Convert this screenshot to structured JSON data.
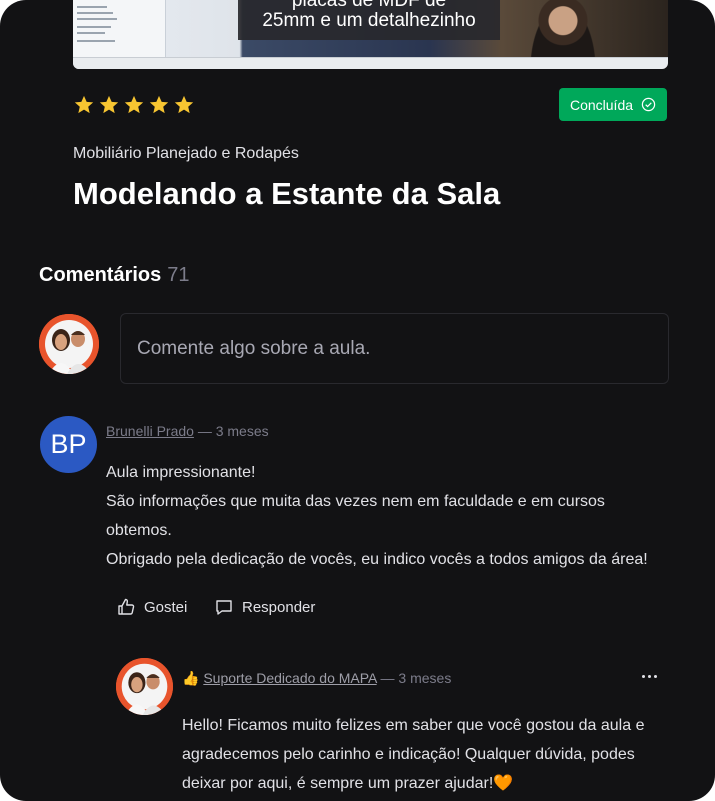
{
  "video": {
    "caption_line1": "placas de MDF de",
    "caption_line2": "25mm e um detalhezinho"
  },
  "lesson": {
    "rating": 5,
    "status_label": "Concluída",
    "module": "Mobiliário Planejado e Rodapés",
    "title": "Modelando a Estante da Sala"
  },
  "comments": {
    "heading": "Comentários",
    "count": "71",
    "input_placeholder": "Comente algo sobre a aula.",
    "items": [
      {
        "initials": "BP",
        "author": "Brunelli Prado",
        "time": " — 3 meses",
        "lines": [
          "Aula impressionante!",
          "São informações que muita das vezes nem em faculdade e em cursos",
          "obtemos.",
          "Obrigado pela dedicação de vocês, eu indico vocês a todos amigos da área!"
        ],
        "like_label": "Gostei",
        "reply_label": "Responder",
        "replies": [
          {
            "author_prefix": "👍 ",
            "author": "Suporte Dedicado do MAPA",
            "time": " — 3 meses",
            "lines": [
              "Hello! Ficamos muito felizes em saber que você gostou da aula e",
              "agradecemos pelo carinho e indicação! Qualquer dúvida, podes",
              "deixar por aqui, é sempre um prazer ajudar!🧡"
            ]
          }
        ]
      }
    ]
  },
  "colors": {
    "background": "#121214",
    "accent_green": "#00a85a",
    "star": "#f7c531",
    "initials_bg": "#2b59c3"
  }
}
